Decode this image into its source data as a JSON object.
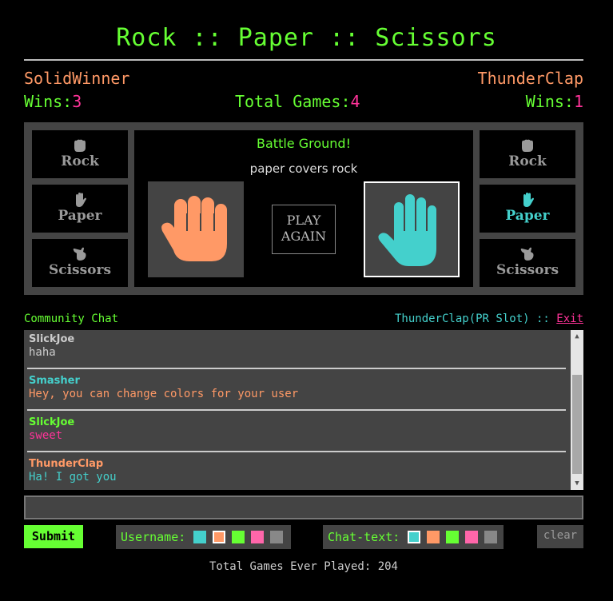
{
  "title": "Rock :: Paper :: Scissors",
  "player1": {
    "name": "SolidWinner",
    "wins_label": "Wins:",
    "wins": "3"
  },
  "player2": {
    "name": "ThunderClap",
    "wins_label": "Wins:",
    "wins": "1"
  },
  "total_games": {
    "label": "Total Games:",
    "value": "4"
  },
  "choices_left": [
    {
      "label": "Rock",
      "icon": "fist-icon"
    },
    {
      "label": "Paper",
      "icon": "open-hand-icon"
    },
    {
      "label": "Scissors",
      "icon": "scissors-hand-icon"
    }
  ],
  "choices_right": [
    {
      "label": "Rock",
      "icon": "fist-icon"
    },
    {
      "label": "Paper",
      "icon": "open-hand-icon",
      "selected": true
    },
    {
      "label": "Scissors",
      "icon": "scissors-hand-icon"
    }
  ],
  "battle": {
    "title": "Battle Ground!",
    "result": "paper covers rock",
    "play_again_line1": "PLAY",
    "play_again_line2": "AGAIN",
    "left_hand": "fist-icon",
    "right_hand": "open-hand-icon"
  },
  "chat": {
    "title": "Community Chat",
    "user_info": "ThunderClap(PR Slot) :: ",
    "exit_label": "Exit",
    "messages": [
      {
        "user": "SlickJoe",
        "text": "haha",
        "user_color": "#cccccc",
        "text_color": "#cccccc"
      },
      {
        "user": "Smasher",
        "text": "Hey, you can change colors for your user",
        "user_color": "#44d0cc",
        "text_color": "#ff9966"
      },
      {
        "user": "SlickJoe",
        "text": "sweet",
        "user_color": "#66ff33",
        "text_color": "#ff3399"
      },
      {
        "user": "ThunderClap",
        "text": "Ha! I got you",
        "user_color": "#ff9966",
        "text_color": "#44d0cc"
      }
    ]
  },
  "controls": {
    "submit_label": "Submit",
    "username_label": "Username:",
    "chattext_label": "Chat-text:",
    "clear_label": "clear",
    "swatches": [
      "#44d0cc",
      "#ff9966",
      "#66ff33",
      "#ff66aa",
      "#888888"
    ]
  },
  "footer": "Total Games Ever Played: 204",
  "colors": {
    "green": "#66ff33",
    "orange": "#ff9966",
    "pink": "#ff3399",
    "teal": "#44d0cc"
  }
}
